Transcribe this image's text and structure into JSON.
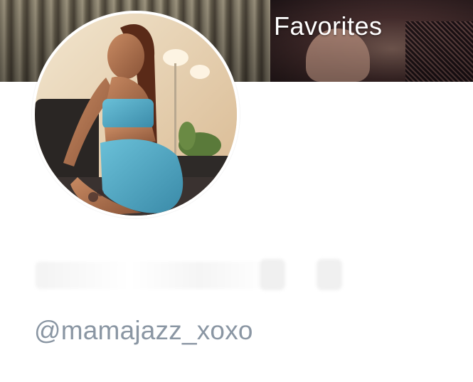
{
  "cover": {
    "title": "Favorites"
  },
  "profile": {
    "display_name": "",
    "handle": "@mamajazz_xoxo"
  },
  "colors": {
    "handle_text": "#8a96a3",
    "cover_title_text": "#ffffff",
    "background": "#ffffff"
  },
  "icons": {
    "avatar": "profile-photo"
  }
}
